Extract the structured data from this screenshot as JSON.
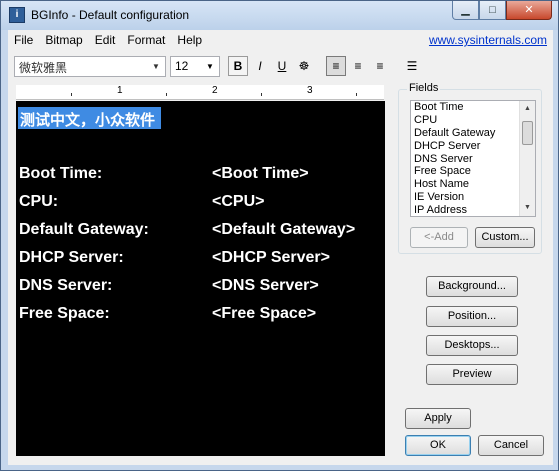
{
  "window": {
    "title": "BGInfo - Default configuration",
    "app_icon_glyph": "i",
    "minimize": "▁",
    "maximize": "□",
    "close": "✕"
  },
  "menu": {
    "items": [
      "File",
      "Bitmap",
      "Edit",
      "Format",
      "Help"
    ],
    "link": "www.sysinternals.com"
  },
  "toolbar": {
    "font": "微软雅黑",
    "size": "12",
    "bold": "B",
    "italic": "I",
    "underline": "U",
    "color_glyph": "☸",
    "align_left": "≡",
    "align_center": "≡",
    "align_right": "≡",
    "bullets": "☰"
  },
  "ruler": {
    "numbers": [
      "1",
      "2",
      "3"
    ]
  },
  "editor": {
    "heading": "测试中文，小众软件",
    "rows": [
      {
        "label": "Boot Time:",
        "value": "<Boot Time>"
      },
      {
        "label": "CPU:",
        "value": "<CPU>"
      },
      {
        "label": "Default Gateway:",
        "value": "<Default Gateway>"
      },
      {
        "label": "DHCP Server:",
        "value": "<DHCP Server>"
      },
      {
        "label": "DNS Server:",
        "value": "<DNS Server>"
      },
      {
        "label": "Free Space:",
        "value": "<Free Space>"
      }
    ]
  },
  "fields": {
    "label": "Fields",
    "items": [
      "Boot Time",
      "CPU",
      "Default Gateway",
      "DHCP Server",
      "DNS Server",
      "Free Space",
      "Host Name",
      "IE Version",
      "IP Address"
    ],
    "add": "<-Add",
    "custom": "Custom..."
  },
  "buttons": {
    "background": "Background...",
    "position": "Position...",
    "desktops": "Desktops...",
    "preview": "Preview",
    "apply": "Apply",
    "ok": "OK",
    "cancel": "Cancel"
  },
  "colors": {
    "editor_bg": "#000000",
    "editor_text": "#ffffff",
    "selection": "#3f8be3",
    "link": "#0033cc"
  }
}
